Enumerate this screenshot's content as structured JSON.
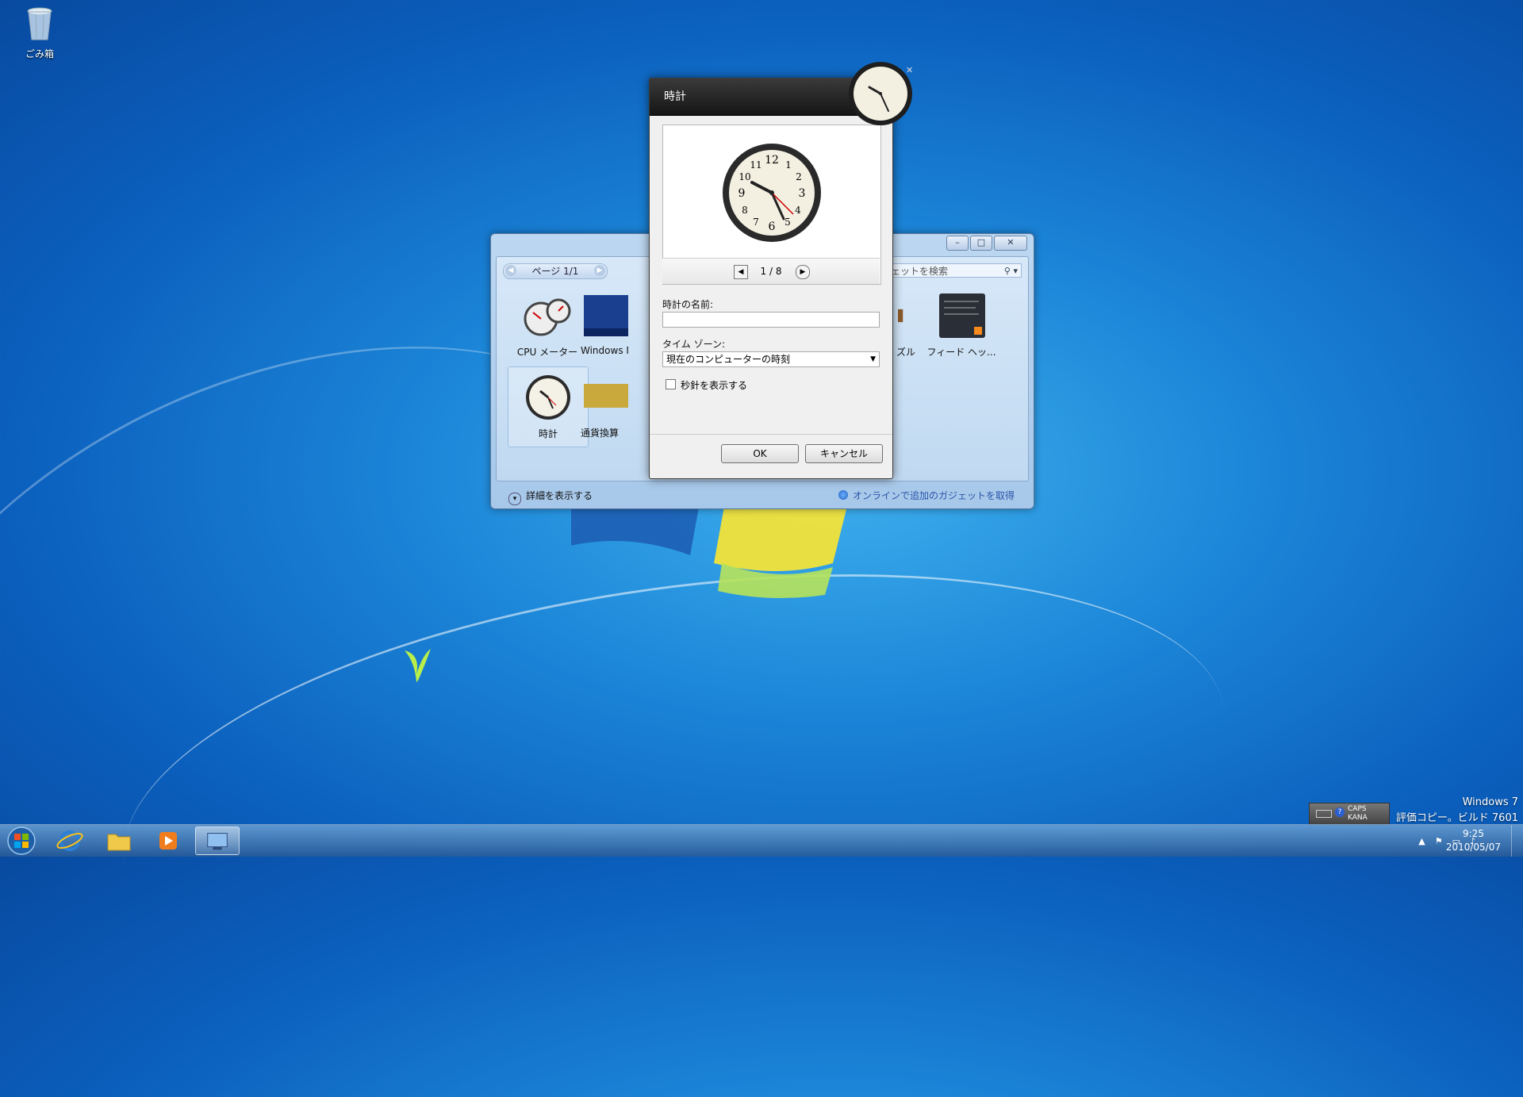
{
  "desktop": {
    "recycle_bin_label": "ごみ箱",
    "watermark_line1": "Windows 7",
    "watermark_line2": "評価コピー。ビルド 7601"
  },
  "gallery": {
    "pager_label": "ページ 1/1",
    "search_placeholder": "ェットを検索",
    "gadgets": [
      {
        "label": "CPU メーター"
      },
      {
        "label": "Windows Me"
      },
      {
        "label": "ズル"
      },
      {
        "label": "フィード ヘッ..."
      },
      {
        "label": "時計"
      },
      {
        "label": "通貨換算"
      }
    ],
    "details_label": "詳細を表示する",
    "online_label": "オンラインで追加のガジェットを取得"
  },
  "dialog": {
    "title": "時計",
    "page_indicator": "1 / 8",
    "name_label": "時計の名前:",
    "name_value": "",
    "timezone_label": "タイム ゾーン:",
    "timezone_value": "現在のコンピューターの時刻",
    "second_hand_label": "秒針を表示する",
    "second_hand_checked": false,
    "ok_label": "OK",
    "cancel_label": "キャンセル"
  },
  "taskbar": {
    "pinned": [
      {
        "name": "start-orb"
      },
      {
        "name": "internet-explorer-icon"
      },
      {
        "name": "explorer-folder-icon"
      },
      {
        "name": "media-player-icon"
      },
      {
        "name": "gadgets-icon"
      }
    ],
    "time": "9:25",
    "date": "2010/05/07",
    "ime_caps": "CAPS",
    "ime_kana": "KANA"
  }
}
